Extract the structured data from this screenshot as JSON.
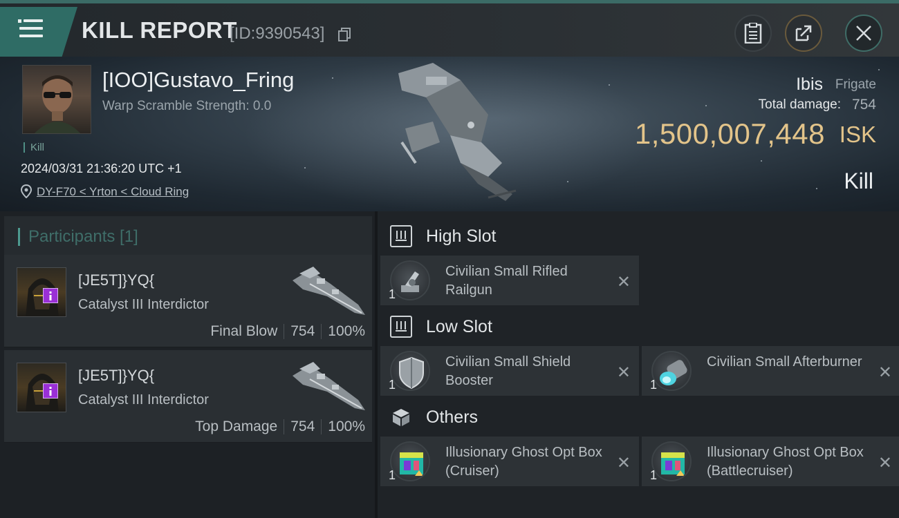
{
  "header": {
    "title": "KILL REPORT",
    "report_id": "[ID:9390543]",
    "icons": [
      "menu-icon",
      "copy-icon",
      "clipboard-icon",
      "share-icon",
      "close-icon"
    ]
  },
  "victim": {
    "pilot_name": "[IOO]Gustavo_Fring",
    "warp_scramble": "Warp Scramble Strength: 0.0",
    "tag": "Kill",
    "datetime": "2024/03/31 21:36:20 UTC +1",
    "location": "DY-F70 < Yrton < Cloud Ring",
    "ship_name": "Ibis",
    "ship_class": "Frigate",
    "total_damage_label": "Total damage:",
    "total_damage": "754",
    "isk_value": "1,500,007,448",
    "isk_unit": "ISK",
    "result": "Kill"
  },
  "participants": {
    "title": "Participants [1]",
    "items": [
      {
        "name": "[JE5T]}YQ{",
        "ship": "Catalyst III Interdictor",
        "role": "Final Blow",
        "damage": "754",
        "percent": "100%"
      },
      {
        "name": "[JE5T]}YQ{",
        "ship": "Catalyst III Interdictor",
        "role": "Top Damage",
        "damage": "754",
        "percent": "100%"
      }
    ]
  },
  "fitting": {
    "high_slot": {
      "label": "High Slot",
      "items": [
        {
          "name": "Civilian Small Rifled Railgun",
          "qty": "1"
        }
      ]
    },
    "low_slot": {
      "label": "Low Slot",
      "items": [
        {
          "name": "Civilian Small Shield Booster",
          "qty": "1"
        },
        {
          "name": "Civilian Small Afterburner",
          "qty": "1"
        }
      ]
    },
    "others": {
      "label": "Others",
      "items": [
        {
          "name": "Illusionary Ghost Opt Box (Cruiser)",
          "qty": "1"
        },
        {
          "name": "Illusionary Ghost Opt Box (Battlecruiser)",
          "qty": "1"
        }
      ]
    },
    "remove_glyph": "✕"
  },
  "colors": {
    "accent": "#2f6c65",
    "isk_gold": "#e3c48a",
    "participants_title": "#3f6e69",
    "badge_purple": "#9a2fd6"
  }
}
